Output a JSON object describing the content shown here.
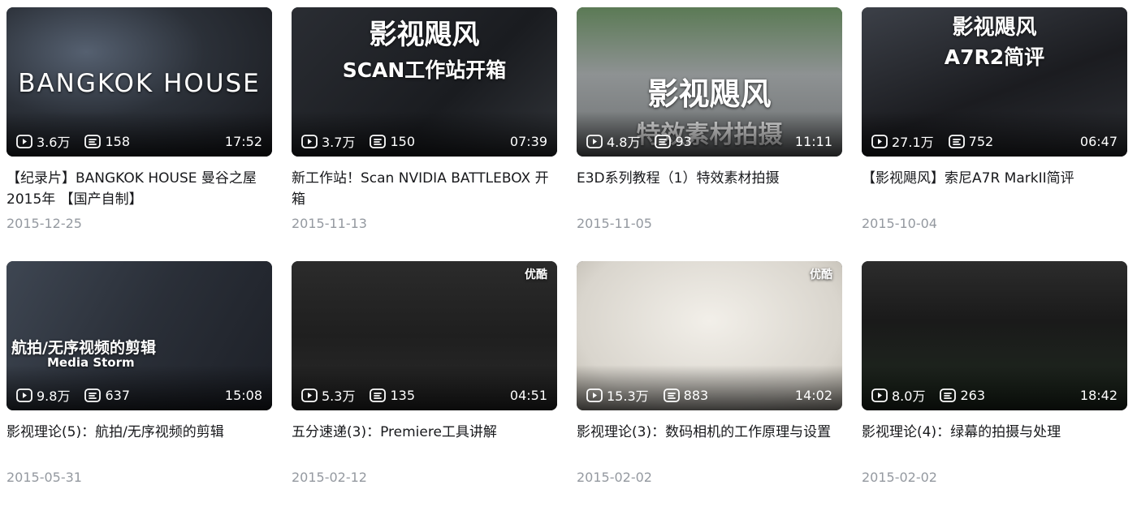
{
  "videos": [
    {
      "title": "【纪录片】BANGKOK HOUSE 曼谷之屋 2015年 【国产自制】",
      "views": "3.6万",
      "comments": "158",
      "duration": "17:52",
      "date": "2015-12-25",
      "overlay_line1": "BANGKOK HOUSE",
      "overlay_line2": ""
    },
    {
      "title": "新工作站！Scan NVIDIA BATTLEBOX 开箱",
      "views": "3.7万",
      "comments": "150",
      "duration": "07:39",
      "date": "2015-11-13",
      "overlay_line1": "影视飓风",
      "overlay_line2": "SCAN工作站开箱"
    },
    {
      "title": "E3D系列教程（1）特效素材拍摄",
      "views": "4.8万",
      "comments": "93",
      "duration": "11:11",
      "date": "2015-11-05",
      "overlay_line1": "影视飓风",
      "overlay_line2": "特效素材拍摄"
    },
    {
      "title": "【影视飓风】索尼A7R MarkII简评",
      "views": "27.1万",
      "comments": "752",
      "duration": "06:47",
      "date": "2015-10-04",
      "overlay_line1": "影视飓风",
      "overlay_line2": "A7R2简评"
    },
    {
      "title": "影视理论(5)：航拍/无序视频的剪辑",
      "views": "9.8万",
      "comments": "637",
      "duration": "15:08",
      "date": "2015-05-31",
      "overlay_line1": "航拍/无序视频的剪辑",
      "overlay_line2": "Media Storm"
    },
    {
      "title": "五分速递(3)：Premiere工具讲解",
      "views": "5.3万",
      "comments": "135",
      "duration": "04:51",
      "date": "2015-02-12",
      "overlay_line1": "优酷",
      "overlay_line2": ""
    },
    {
      "title": "影视理论(3)：数码相机的工作原理与设置",
      "views": "15.3万",
      "comments": "883",
      "duration": "14:02",
      "date": "2015-02-02",
      "overlay_line1": "优酷",
      "overlay_line2": ""
    },
    {
      "title": "影视理论(4)：绿幕的拍摄与处理",
      "views": "8.0万",
      "comments": "263",
      "duration": "18:42",
      "date": "2015-02-02",
      "overlay_line1": "",
      "overlay_line2": ""
    }
  ],
  "icons": {
    "views": "play-count-icon",
    "comments": "danmaku-count-icon"
  },
  "colors": {
    "title": "#18191c",
    "date": "#9499a0",
    "stat_text": "#ffffff"
  }
}
